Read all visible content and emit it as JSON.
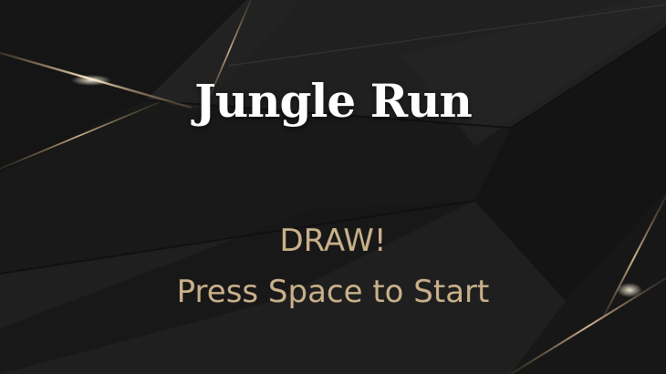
{
  "game": {
    "title": "Jungle Run",
    "status": "DRAW!",
    "prompt": "Press Space to Start"
  },
  "colors": {
    "background": "#1c1c1c",
    "title_text": "#ffffff",
    "accent_text": "#c9b08a",
    "gold_line": "#d8b88a"
  }
}
